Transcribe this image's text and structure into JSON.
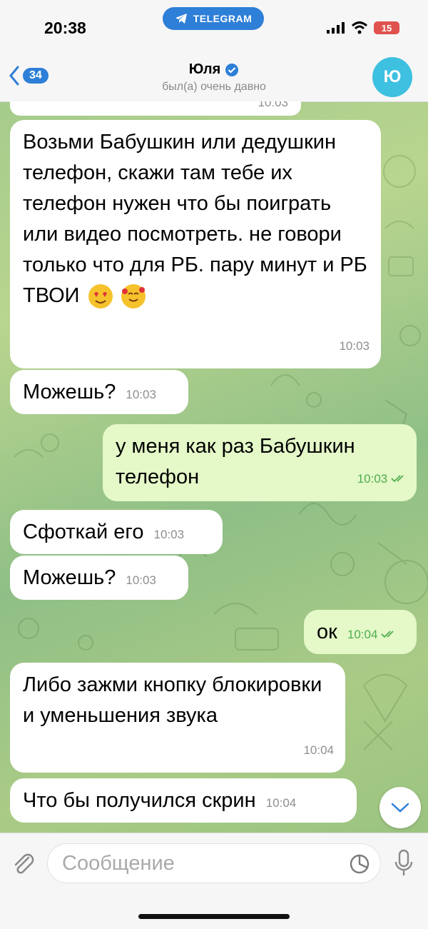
{
  "status_bar": {
    "time": "20:38",
    "pill_label": "TELEGRAM",
    "battery": "15"
  },
  "header": {
    "back_count": "34",
    "name": "Юля",
    "status": "был(а) очень давно",
    "avatar_letter": "Ю"
  },
  "messages": [
    {
      "side": "in",
      "text": "Возьми Бабушкин или дедушкин  телефон, скажи там тебе их телефон нужен что бы поиграть или видео посмотреть. не говори только что для РБ. пару минут и РБ ТВОИ",
      "time": "10:03"
    },
    {
      "side": "in",
      "text": "Можешь?",
      "time": "10:03"
    },
    {
      "side": "out",
      "text": "у меня как раз Бабушкин телефон",
      "time": "10:03"
    },
    {
      "side": "in",
      "text": "Сфоткай его",
      "time": "10:03"
    },
    {
      "side": "in",
      "text": "Можешь?",
      "time": "10:03"
    },
    {
      "side": "out",
      "text": "ок",
      "time": "10:04"
    },
    {
      "side": "in",
      "text": "Либо зажми кнопку блокировки и уменьшения звука",
      "time": "10:04"
    },
    {
      "side": "in",
      "text": "Что бы получился скрин",
      "time": "10:04"
    }
  ],
  "prev_message_time": "10:03",
  "input": {
    "placeholder": "Сообщение"
  },
  "colors": {
    "accent": "#2e7fd7",
    "avatar": "#3ec0e0",
    "outgoing_bubble": "#e4f8c8",
    "incoming_bubble": "#ffffff",
    "read_ticks": "#4fae4e"
  }
}
